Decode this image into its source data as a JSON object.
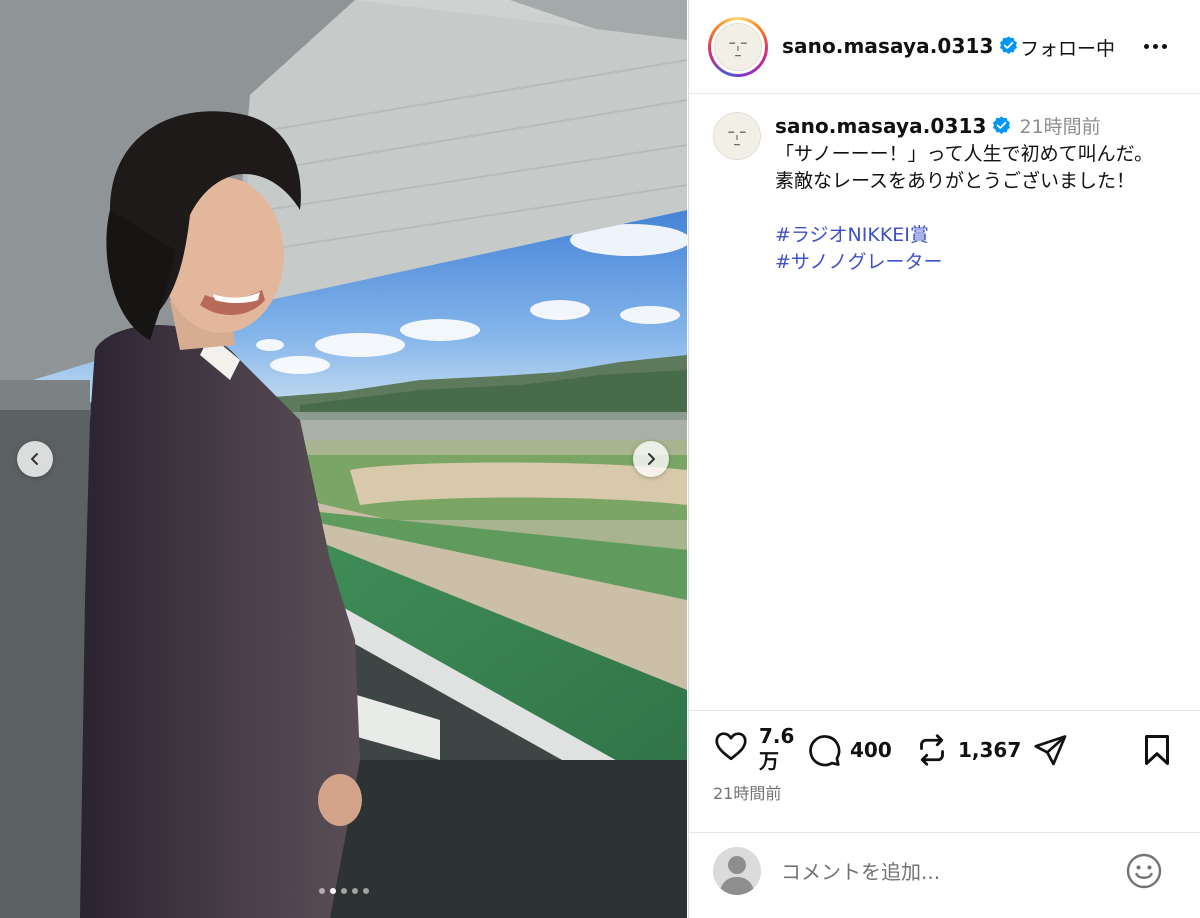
{
  "post": {
    "username": "sano.masaya.0313",
    "follow_label": "フォロー中",
    "caption_time": "21時間前",
    "caption_lines": "「サノーーー！」って人生で初めて叫んだ。\n素敵なレースをありがとうございました！",
    "hashtags": [
      "#ラジオNIKKEI賞",
      "#サノノグレーター"
    ],
    "likes": "7.6万",
    "comments": "400",
    "reposts": "1,367",
    "posted_time": "21時間前",
    "comment_placeholder": "コメントを追加..."
  },
  "carousel": {
    "total_slides": 5,
    "active_slide": 2
  },
  "colors": {
    "verified": "#0095f6",
    "hashtag": "#3d52c7",
    "muted": "#737373"
  }
}
